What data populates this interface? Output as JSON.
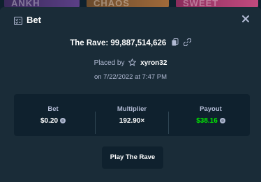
{
  "background": {
    "thumbnails": [
      "ANKH",
      "CHAOS",
      "SWEET"
    ]
  },
  "modal": {
    "title": "Bet",
    "title_icon": "bet-slip-icon",
    "close_icon": "close-icon"
  },
  "bet": {
    "game_label": "The Rave: 99,887,514,626",
    "copy_icon": "copy-icon",
    "link_icon": "link-icon",
    "placed_by_prefix": "Placed by",
    "user_icon": "star-icon",
    "username": "xyron32",
    "date_text": "on 7/22/2022 at 7:47 PM"
  },
  "stats": {
    "bet_label": "Bet",
    "bet_value": "$0.20",
    "multiplier_label": "Multiplier",
    "multiplier_value": "192.90×",
    "payout_label": "Payout",
    "payout_value": "$38.16",
    "currency_icon": "coin-icon"
  },
  "actions": {
    "play_label": "Play The Rave"
  },
  "colors": {
    "modal_bg": "#1a2c38",
    "panel_bg": "#0f212e",
    "muted_text": "#b1bad3",
    "payout_green": "#00e701"
  }
}
